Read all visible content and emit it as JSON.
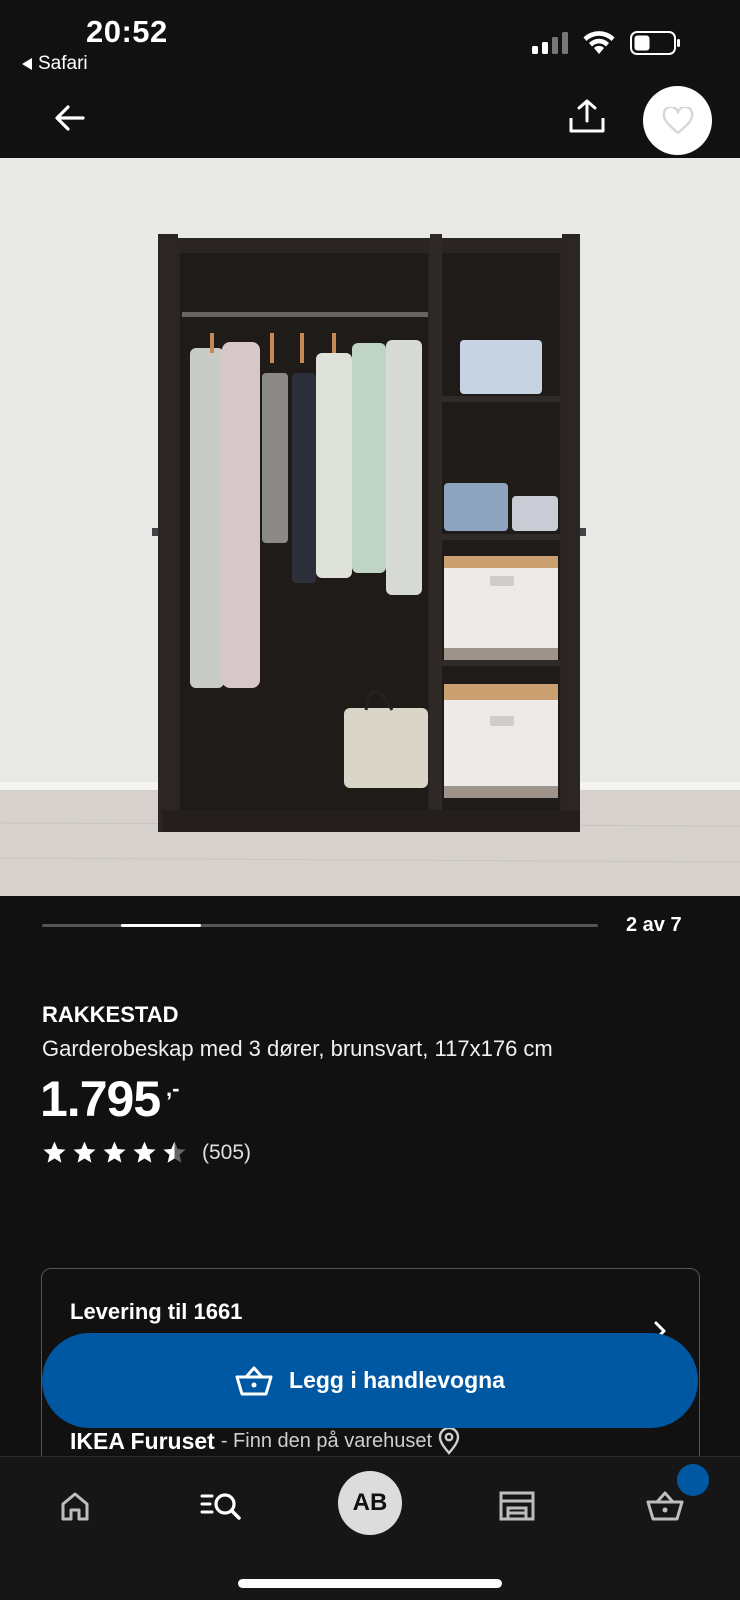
{
  "status_bar": {
    "time": "20:52",
    "back_app": "Safari",
    "icons": [
      "cellular-signal-icon",
      "wifi-icon",
      "battery-icon"
    ]
  },
  "header": {
    "icons": [
      "arrow-left-icon",
      "share-icon",
      "heart-icon"
    ]
  },
  "product_image": {
    "description_icon": "wardrobe-photo"
  },
  "gallery": {
    "counter": "2 av 7",
    "current": 2,
    "total": 7
  },
  "product": {
    "name": "RAKKESTAD",
    "description": "Garderobeskap med 3 dører, brunsvart, 117x176 cm",
    "price": "1.795",
    "price_suffix": ",-",
    "rating_value": 4.5,
    "rating_max": 5,
    "review_count": "(505)"
  },
  "delivery": {
    "title": "Levering til 1661",
    "store_name": "IKEA Furuset",
    "store_hint": " - Finn den på varehuset",
    "icons": [
      "chevron-right-icon",
      "location-pin-icon"
    ]
  },
  "cart_button": {
    "label": "Legg i handlevogna",
    "icon": "shopping-basket-icon"
  },
  "tab_bar": {
    "avatar_initials": "AB",
    "tabs": [
      "home-icon",
      "search-list-icon",
      "avatar",
      "store-icon",
      "cart-icon"
    ]
  },
  "colors": {
    "background": "#111111",
    "accent_blue": "#0058a3",
    "white": "#ffffff"
  }
}
